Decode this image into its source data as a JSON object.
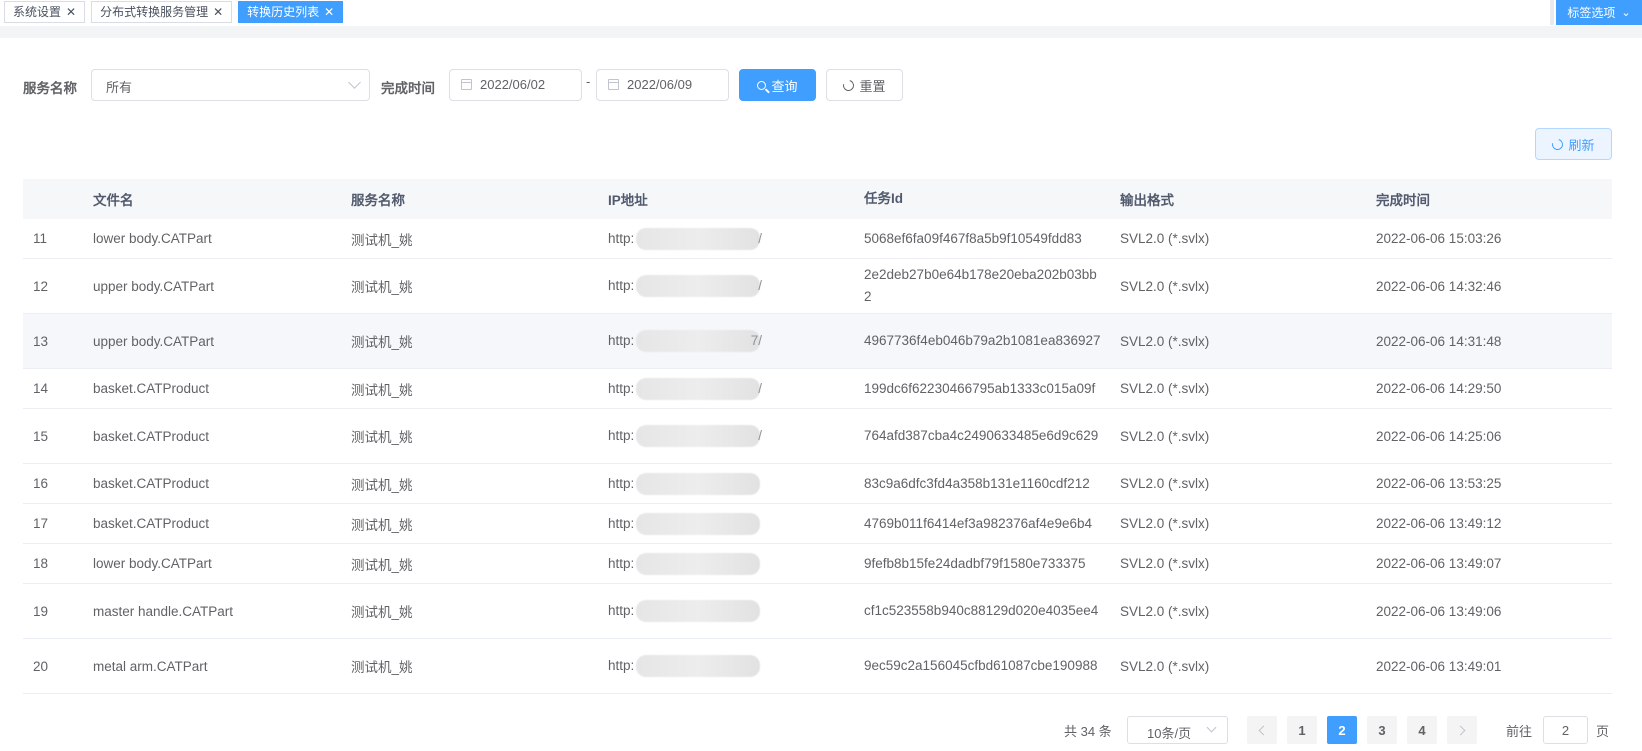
{
  "tabs": [
    {
      "label": "系统设置",
      "active": false
    },
    {
      "label": "分布式转换服务管理",
      "active": false
    },
    {
      "label": "转换历史列表",
      "active": true
    }
  ],
  "tab_options_label": "标签选项",
  "search": {
    "service_label": "服务名称",
    "service_value": "所有",
    "time_label": "完成时间",
    "date_start": "2022/06/02",
    "date_sep": "-",
    "date_end": "2022/06/09",
    "query_label": "查询",
    "reset_label": "重置"
  },
  "refresh_label": "刷新",
  "table": {
    "columns": [
      "",
      "文件名",
      "服务名称",
      "IP地址",
      "任务Id",
      "输出格式",
      "完成时间"
    ],
    "rows": [
      {
        "idx": "11",
        "file": "lower body.CATPart",
        "service": "测试机_姚",
        "ip_prefix": "http:",
        "ip_tail": "/",
        "task": "5068ef6fa09f467f8a5b9f10549fdd83",
        "format": "SVL2.0 (*.svlx)",
        "time": "2022-06-06 15:03:26"
      },
      {
        "idx": "12",
        "file": "upper body.CATPart",
        "service": "测试机_姚",
        "ip_prefix": "http:",
        "ip_tail": "/",
        "task": "2e2deb27b0e64b178e20eba202b03bb2",
        "format": "SVL2.0 (*.svlx)",
        "time": "2022-06-06 14:32:46"
      },
      {
        "idx": "13",
        "file": "upper body.CATPart",
        "service": "测试机_姚",
        "ip_prefix": "http:",
        "ip_tail": "7/",
        "task": "4967736f4eb046b79a2b1081ea836927",
        "format": "SVL2.0 (*.svlx)",
        "time": "2022-06-06 14:31:48"
      },
      {
        "idx": "14",
        "file": "basket.CATProduct",
        "service": "测试机_姚",
        "ip_prefix": "http:",
        "ip_tail": "/",
        "task": "199dc6f62230466795ab1333c015a09f",
        "format": "SVL2.0 (*.svlx)",
        "time": "2022-06-06 14:29:50"
      },
      {
        "idx": "15",
        "file": "basket.CATProduct",
        "service": "测试机_姚",
        "ip_prefix": "http:",
        "ip_tail": "/",
        "task": "764afd387cba4c2490633485e6d9c629",
        "format": "SVL2.0 (*.svlx)",
        "time": "2022-06-06 14:25:06"
      },
      {
        "idx": "16",
        "file": "basket.CATProduct",
        "service": "测试机_姚",
        "ip_prefix": "http:",
        "ip_tail": "",
        "task": "83c9a6dfc3fd4a358b131e1160cdf212",
        "format": "SVL2.0 (*.svlx)",
        "time": "2022-06-06 13:53:25"
      },
      {
        "idx": "17",
        "file": "basket.CATProduct",
        "service": "测试机_姚",
        "ip_prefix": "http:",
        "ip_tail": "",
        "task": "4769b011f6414ef3a982376af4e9e6b4",
        "format": "SVL2.0 (*.svlx)",
        "time": "2022-06-06 13:49:12"
      },
      {
        "idx": "18",
        "file": "lower body.CATPart",
        "service": "测试机_姚",
        "ip_prefix": "http:",
        "ip_tail": "",
        "task": "9fefb8b15fe24dadbf79f1580e733375",
        "format": "SVL2.0 (*.svlx)",
        "time": "2022-06-06 13:49:07"
      },
      {
        "idx": "19",
        "file": "master handle.CATPart",
        "service": "测试机_姚",
        "ip_prefix": "http:",
        "ip_tail": "",
        "task": "cf1c523558b940c88129d020e4035ee4",
        "format": "SVL2.0 (*.svlx)",
        "time": "2022-06-06 13:49:06"
      },
      {
        "idx": "20",
        "file": "metal arm.CATPart",
        "service": "测试机_姚",
        "ip_prefix": "http:",
        "ip_tail": "",
        "task": "9ec59c2a156045cfbd61087cbe190988",
        "format": "SVL2.0 (*.svlx)",
        "time": "2022-06-06 13:49:01"
      }
    ]
  },
  "pagination": {
    "total_text": "共 34 条",
    "page_size": "10条/页",
    "pages": [
      "1",
      "2",
      "3",
      "4"
    ],
    "current_page": "2",
    "goto_label": "前往",
    "goto_value": "2",
    "goto_suffix": "页"
  },
  "colors": {
    "accent": "#409eff",
    "header_bg": "#f6f7f9",
    "highlight_row": "#f5f7fa"
  }
}
